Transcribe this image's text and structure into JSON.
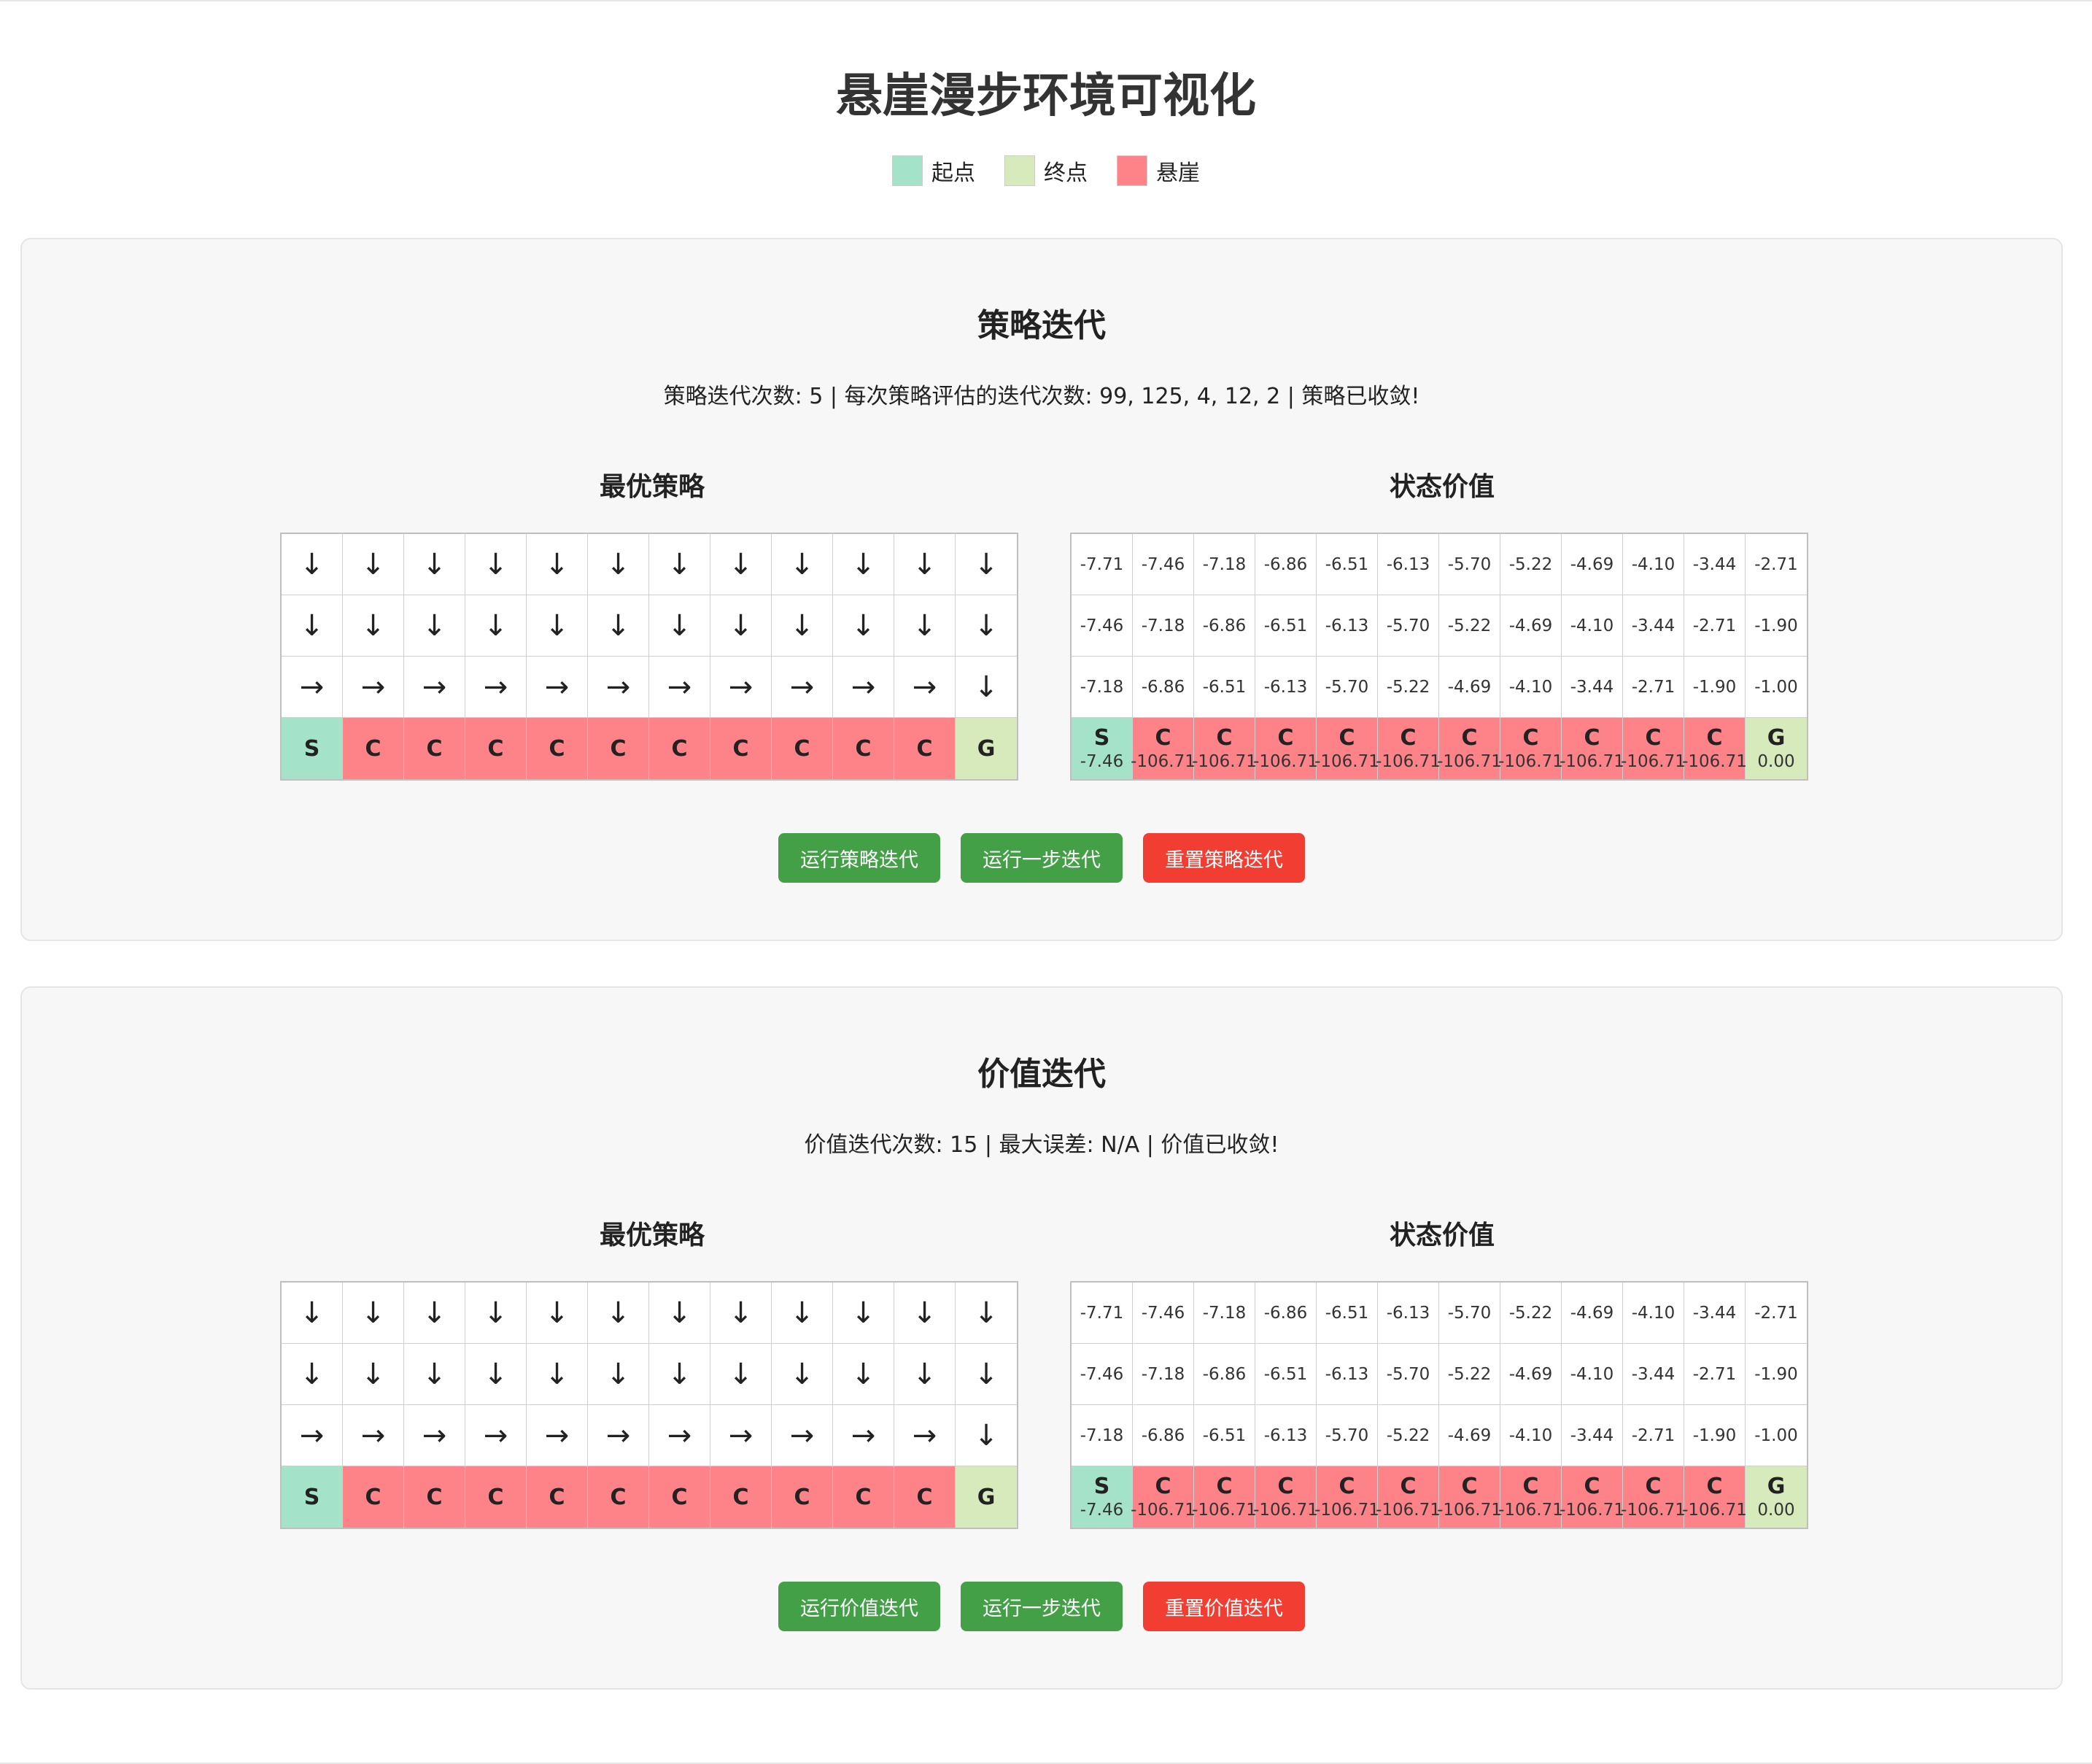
{
  "page_title": "悬崖漫步环境可视化",
  "legend": [
    {
      "label": "起点",
      "color": "#a4e3c9"
    },
    {
      "label": "终点",
      "color": "#d7eabb"
    },
    {
      "label": "悬崖",
      "color": "#fd8389"
    }
  ],
  "sections": [
    {
      "title": "策略迭代",
      "status": "策略迭代次数: 5 | 每次策略评估的迭代次数: 99, 125, 4, 12, 2 | 策略已收敛!",
      "policy_title": "最优策略",
      "values_title": "状态价值",
      "buttons": {
        "run": "运行策略迭代",
        "step": "运行一步迭代",
        "reset": "重置策略迭代"
      }
    },
    {
      "title": "价值迭代",
      "status": "价值迭代次数: 15 | 最大误差: N/A | 价值已收敛!",
      "policy_title": "最优策略",
      "values_title": "状态价值",
      "buttons": {
        "run": "运行价值迭代",
        "step": "运行一步迭代",
        "reset": "重置价值迭代"
      }
    }
  ],
  "grid": {
    "policy": [
      [
        "↓",
        "↓",
        "↓",
        "↓",
        "↓",
        "↓",
        "↓",
        "↓",
        "↓",
        "↓",
        "↓",
        "↓"
      ],
      [
        "↓",
        "↓",
        "↓",
        "↓",
        "↓",
        "↓",
        "↓",
        "↓",
        "↓",
        "↓",
        "↓",
        "↓"
      ],
      [
        "→",
        "→",
        "→",
        "→",
        "→",
        "→",
        "→",
        "→",
        "→",
        "→",
        "→",
        "↓"
      ],
      [
        "S",
        "C",
        "C",
        "C",
        "C",
        "C",
        "C",
        "C",
        "C",
        "C",
        "C",
        "G"
      ]
    ],
    "values": [
      [
        "-7.71",
        "-7.46",
        "-7.18",
        "-6.86",
        "-6.51",
        "-6.13",
        "-5.70",
        "-5.22",
        "-4.69",
        "-4.10",
        "-3.44",
        "-2.71"
      ],
      [
        "-7.46",
        "-7.18",
        "-6.86",
        "-6.51",
        "-6.13",
        "-5.70",
        "-5.22",
        "-4.69",
        "-4.10",
        "-3.44",
        "-2.71",
        "-1.90"
      ],
      [
        "-7.18",
        "-6.86",
        "-6.51",
        "-6.13",
        "-5.70",
        "-5.22",
        "-4.69",
        "-4.10",
        "-3.44",
        "-2.71",
        "-1.90",
        "-1.00"
      ],
      [
        "-7.46",
        "-106.71",
        "-106.71",
        "-106.71",
        "-106.71",
        "-106.71",
        "-106.71",
        "-106.71",
        "-106.71",
        "-106.71",
        "-106.71",
        "0.00"
      ]
    ],
    "bottom_row_labels": [
      "S",
      "C",
      "C",
      "C",
      "C",
      "C",
      "C",
      "C",
      "C",
      "C",
      "C",
      "G"
    ]
  }
}
